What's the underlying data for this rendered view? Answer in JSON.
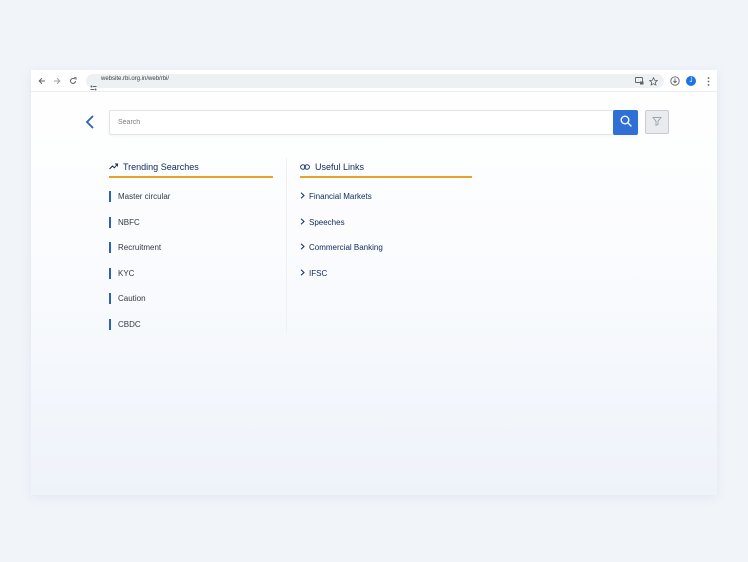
{
  "browser": {
    "url": "website.rbi.org.in/web/rbi/",
    "profile_initial": "J"
  },
  "search": {
    "placeholder": "Search"
  },
  "trending": {
    "heading": "Trending Searches",
    "items": [
      {
        "label": "Master circular"
      },
      {
        "label": "NBFC"
      },
      {
        "label": "Recruitment"
      },
      {
        "label": "KYC"
      },
      {
        "label": "Caution"
      },
      {
        "label": "CBDC"
      }
    ]
  },
  "useful": {
    "heading": "Useful Links",
    "items": [
      {
        "label": "Financial Markets"
      },
      {
        "label": "Speeches"
      },
      {
        "label": "Commercial Banking"
      },
      {
        "label": "IFSC"
      }
    ]
  },
  "colors": {
    "accent": "#2f6fd6",
    "underline": "#e3a42a",
    "heading": "#0e2a5a"
  },
  "icons": [
    "back-arrow-icon",
    "forward-arrow-icon",
    "reload-icon",
    "site-info-icon",
    "cast-icon",
    "star-icon",
    "download-icon",
    "menu-icon",
    "chevron-left-icon",
    "search-icon",
    "filter-icon",
    "trending-icon",
    "link-icon",
    "chevron-right-icon"
  ]
}
